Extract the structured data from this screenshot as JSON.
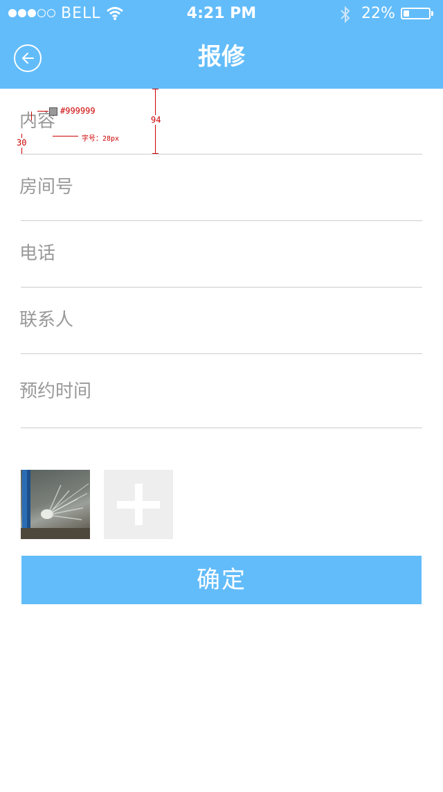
{
  "status_bar": {
    "carrier": "BELL",
    "time": "4:21 PM",
    "battery_text": "22%",
    "battery_level": 0.22,
    "signal_bars_filled": 3,
    "signal_bars_total": 5
  },
  "nav": {
    "title": "报修",
    "back_icon": "back-arrow-circle-icon"
  },
  "form": {
    "fields": [
      {
        "placeholder": "内容",
        "value": ""
      },
      {
        "placeholder": "房间号",
        "value": ""
      },
      {
        "placeholder": "电话",
        "value": ""
      },
      {
        "placeholder": "联系人",
        "value": ""
      },
      {
        "placeholder": "预约时间",
        "value": ""
      }
    ]
  },
  "spec_annotations": {
    "color_code": "#999999",
    "font_size_note": "字号：28px",
    "row_height": "94",
    "left_margin": "30"
  },
  "attachments": {
    "add_icon": "plus-icon"
  },
  "submit": {
    "label": "确定"
  },
  "colors": {
    "accent": "#62bcfa",
    "placeholder": "#999999",
    "divider": "#cccccc",
    "add_tile": "#eeeeee",
    "annotation": "#cc0000"
  }
}
